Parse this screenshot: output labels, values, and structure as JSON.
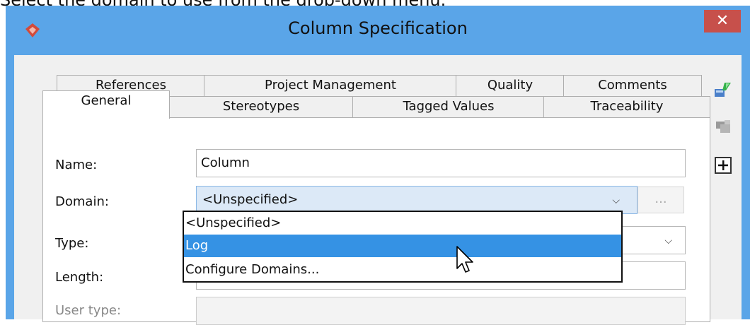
{
  "caption": "Select the domain to use from the drop-down menu.",
  "window": {
    "title": "Column Specification",
    "close_label": "✕"
  },
  "tabs_back": [
    "References",
    "Project Management",
    "Quality",
    "Comments"
  ],
  "tabs_front": [
    "General",
    "Stereotypes",
    "Tagged Values",
    "Traceability"
  ],
  "form": {
    "name_label": "Name:",
    "name_value": "Column",
    "domain_label": "Domain:",
    "domain_value": "<Unspecified>",
    "domain_more": "...",
    "type_label": "Type:",
    "length_label": "Length:",
    "user_type_label": "User type:"
  },
  "domain_options": [
    "<Unspecified>",
    "Log",
    "Configure Domains..."
  ],
  "selected_option": "Log",
  "colors": {
    "titlebar": "#5aa5e8",
    "close": "#c7504b",
    "selection": "#3592e4",
    "combo": "#dce9f7"
  }
}
